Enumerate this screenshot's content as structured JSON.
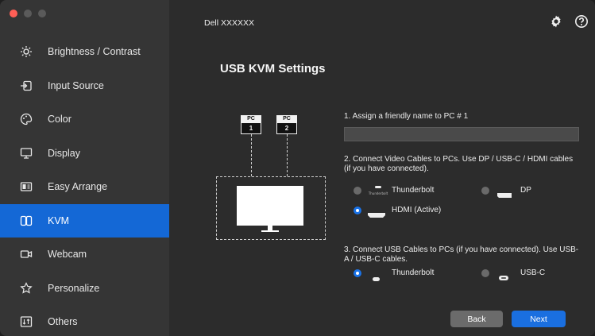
{
  "window": {
    "title": "Dell XXXXXX"
  },
  "sidebar": {
    "items": [
      {
        "label": "Brightness / Contrast",
        "icon": "sun-icon",
        "active": false
      },
      {
        "label": "Input Source",
        "icon": "input-source-icon",
        "active": false
      },
      {
        "label": "Color",
        "icon": "palette-icon",
        "active": false
      },
      {
        "label": "Display",
        "icon": "monitor-icon",
        "active": false
      },
      {
        "label": "Easy Arrange",
        "icon": "layout-icon",
        "active": false
      },
      {
        "label": "KVM",
        "icon": "kvm-icon",
        "active": true
      },
      {
        "label": "Webcam",
        "icon": "webcam-icon",
        "active": false
      },
      {
        "label": "Personalize",
        "icon": "star-icon",
        "active": false
      },
      {
        "label": "Others",
        "icon": "others-icon",
        "active": false
      }
    ]
  },
  "header": {
    "settings_icon": "gear-icon",
    "help_icon": "help-icon"
  },
  "main": {
    "title": "USB KVM Settings",
    "diagram": {
      "pc1_top": "PC",
      "pc1_num": "1",
      "pc2_top": "PC",
      "pc2_num": "2"
    },
    "step1": {
      "label": "1. Assign a friendly name to PC # 1",
      "value": ""
    },
    "step2": {
      "label": "2. Connect Video Cables to PCs. Use DP / USB-C / HDMI cables (if you have connected).",
      "options": [
        {
          "label": "Thunderbolt",
          "icon_text": "Thunderbolt",
          "selected": false
        },
        {
          "label": "DP",
          "selected": false
        },
        {
          "label": "HDMI (Active)",
          "selected": true
        }
      ]
    },
    "step3": {
      "label": "3. Connect USB Cables to PCs (if you have connected). Use USB-A / USB-C cables.",
      "options": [
        {
          "label": "Thunderbolt",
          "selected": true
        },
        {
          "label": "USB-C",
          "selected": false
        }
      ]
    },
    "buttons": {
      "back": "Back",
      "next": "Next"
    }
  },
  "colors": {
    "accent": "#1468d6",
    "sidebar_bg": "#353535",
    "main_bg": "#2c2c2c"
  }
}
